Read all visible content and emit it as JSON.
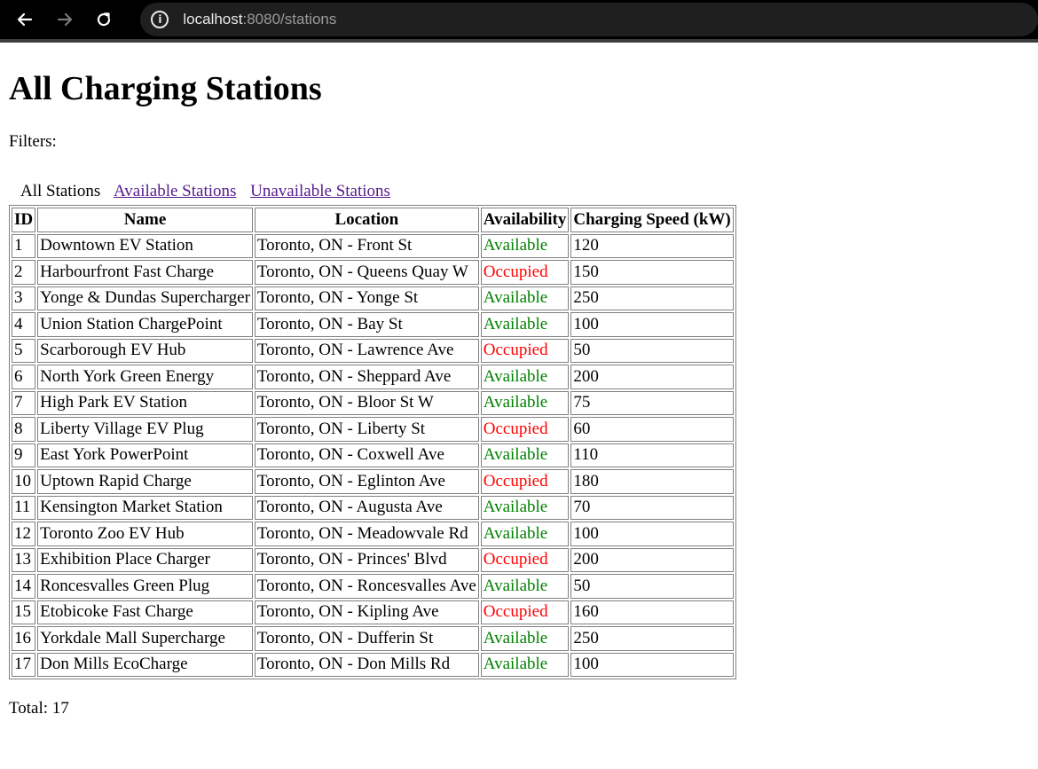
{
  "browser": {
    "url_host": "localhost",
    "url_rest": ":8080/stations"
  },
  "page": {
    "title": "All Charging Stations",
    "filters_label": "Filters:",
    "filters": {
      "all": "All Stations",
      "available": "Available Stations",
      "unavailable": "Unavailable Stations"
    },
    "total": "Total: 17"
  },
  "colors": {
    "available": "#008000",
    "occupied": "#ff0000",
    "visited_link": "#551a8b"
  },
  "table": {
    "headers": [
      "ID",
      "Name",
      "Location",
      "Availability",
      "Charging Speed (kW)"
    ],
    "rows": [
      [
        "1",
        "Downtown EV Station",
        "Toronto, ON - Front St",
        "Available",
        "120"
      ],
      [
        "2",
        "Harbourfront Fast Charge",
        "Toronto, ON - Queens Quay W",
        "Occupied",
        "150"
      ],
      [
        "3",
        "Yonge & Dundas Supercharger",
        "Toronto, ON - Yonge St",
        "Available",
        "250"
      ],
      [
        "4",
        "Union Station ChargePoint",
        "Toronto, ON - Bay St",
        "Available",
        "100"
      ],
      [
        "5",
        "Scarborough EV Hub",
        "Toronto, ON - Lawrence Ave",
        "Occupied",
        "50"
      ],
      [
        "6",
        "North York Green Energy",
        "Toronto, ON - Sheppard Ave",
        "Available",
        "200"
      ],
      [
        "7",
        "High Park EV Station",
        "Toronto, ON - Bloor St W",
        "Available",
        "75"
      ],
      [
        "8",
        "Liberty Village EV Plug",
        "Toronto, ON - Liberty St",
        "Occupied",
        "60"
      ],
      [
        "9",
        "East York PowerPoint",
        "Toronto, ON - Coxwell Ave",
        "Available",
        "110"
      ],
      [
        "10",
        "Uptown Rapid Charge",
        "Toronto, ON - Eglinton Ave",
        "Occupied",
        "180"
      ],
      [
        "11",
        "Kensington Market Station",
        "Toronto, ON - Augusta Ave",
        "Available",
        "70"
      ],
      [
        "12",
        "Toronto Zoo EV Hub",
        "Toronto, ON - Meadowvale Rd",
        "Available",
        "100"
      ],
      [
        "13",
        "Exhibition Place Charger",
        "Toronto, ON - Princes' Blvd",
        "Occupied",
        "200"
      ],
      [
        "14",
        "Roncesvalles Green Plug",
        "Toronto, ON - Roncesvalles Ave",
        "Available",
        "50"
      ],
      [
        "15",
        "Etobicoke Fast Charge",
        "Toronto, ON - Kipling Ave",
        "Occupied",
        "160"
      ],
      [
        "16",
        "Yorkdale Mall Supercharge",
        "Toronto, ON - Dufferin St",
        "Available",
        "250"
      ],
      [
        "17",
        "Don Mills EcoCharge",
        "Toronto, ON - Don Mills Rd",
        "Available",
        "100"
      ]
    ]
  }
}
